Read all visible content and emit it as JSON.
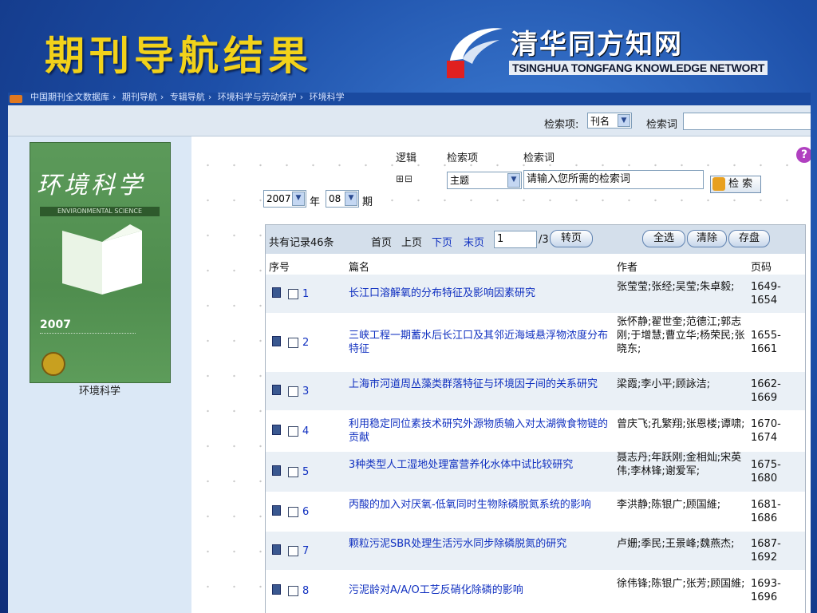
{
  "slide": {
    "title": "期刊导航结果",
    "logo_cn": "清华同方知网",
    "logo_en": "TSINGHUA TONGFANG KNOWLEDGE NETWORT"
  },
  "breadcrumb": [
    "中国期刊全文数据库",
    "期刊导航",
    "专辑导航",
    "环境科学与劳动保护",
    "环境科学"
  ],
  "search_strip": {
    "field_label": "检索项:",
    "field_value": "刊名",
    "keyword_label": "检索词",
    "keyword_value": ""
  },
  "journal": {
    "cover_title": "环境科学",
    "cover_en": "ENVIRONMENTAL SCIENCE",
    "cover_year": "2007",
    "caption": "环境科学"
  },
  "filter": {
    "logic_label": "逻辑",
    "field_label": "检索项",
    "keyword_label": "检索词",
    "plus_minus": "⊞⊟",
    "field_value": "主题",
    "keyword_placeholder": "请输入您所需的检索词",
    "search_button": "检 索",
    "help": "?"
  },
  "date": {
    "year": "2007",
    "year_unit": "年",
    "issue": "08",
    "issue_unit": "期"
  },
  "results": {
    "total_label": "共有记录46条",
    "first": "首页",
    "prev": "上页",
    "next": "下页",
    "last": "末页",
    "page_value": "1",
    "page_total": "/3",
    "goto": "转页",
    "select_all": "全选",
    "clear": "清除",
    "save": "存盘",
    "headers": {
      "seq": "序号",
      "title": "篇名",
      "author": "作者",
      "pages": "页码"
    },
    "rows": [
      {
        "num": "1",
        "title": "长江口溶解氧的分布特征及影响因素研究",
        "authors": "张莹莹;张经;吴莹;朱卓毅;",
        "pages": "1649-1654"
      },
      {
        "num": "2",
        "title": "三峡工程一期蓄水后长江口及其邻近海域悬浮物浓度分布特征",
        "authors": "张怀静;翟世奎;范德江;郭志刚;于增慧;曹立华;杨荣民;张晓东;",
        "pages": "1655-1661"
      },
      {
        "num": "3",
        "title": "上海市河道周丛藻类群落特征与环境因子间的关系研究",
        "authors": "梁霞;李小平;顾詠洁;",
        "pages": "1662-1669"
      },
      {
        "num": "4",
        "title": "利用稳定同位素技术研究外源物质输入对太湖微食物链的贡献",
        "authors": "曾庆飞;孔繁翔;张恩楼;谭啸;",
        "pages": "1670-1674"
      },
      {
        "num": "5",
        "title": "3种类型人工湿地处理富营养化水体中试比较研究",
        "authors": "聂志丹;年跃刚;金相灿;宋英伟;李林锋;谢爱军;",
        "pages": "1675-1680"
      },
      {
        "num": "6",
        "title": "丙酸的加入对厌氧-低氧同时生物除磷脱氮系统的影响",
        "authors": "李洪静;陈银广;顾国維;",
        "pages": "1681-1686"
      },
      {
        "num": "7",
        "title": "颗粒污泥SBR处理生活污水同步除磷脱氮的研究",
        "authors": "卢姗;季民;王景峰;魏燕杰;",
        "pages": "1687-1692"
      },
      {
        "num": "8",
        "title": "污泥龄对A/A/O工艺反硝化除磷的影响",
        "authors": "徐伟锋;陈银广;张芳;顾国維;",
        "pages": "1693-1696"
      }
    ]
  },
  "colors": {
    "slide_title": "#f2d21a",
    "link": "#1030c0",
    "slide_bg": "#1d4fa8"
  }
}
